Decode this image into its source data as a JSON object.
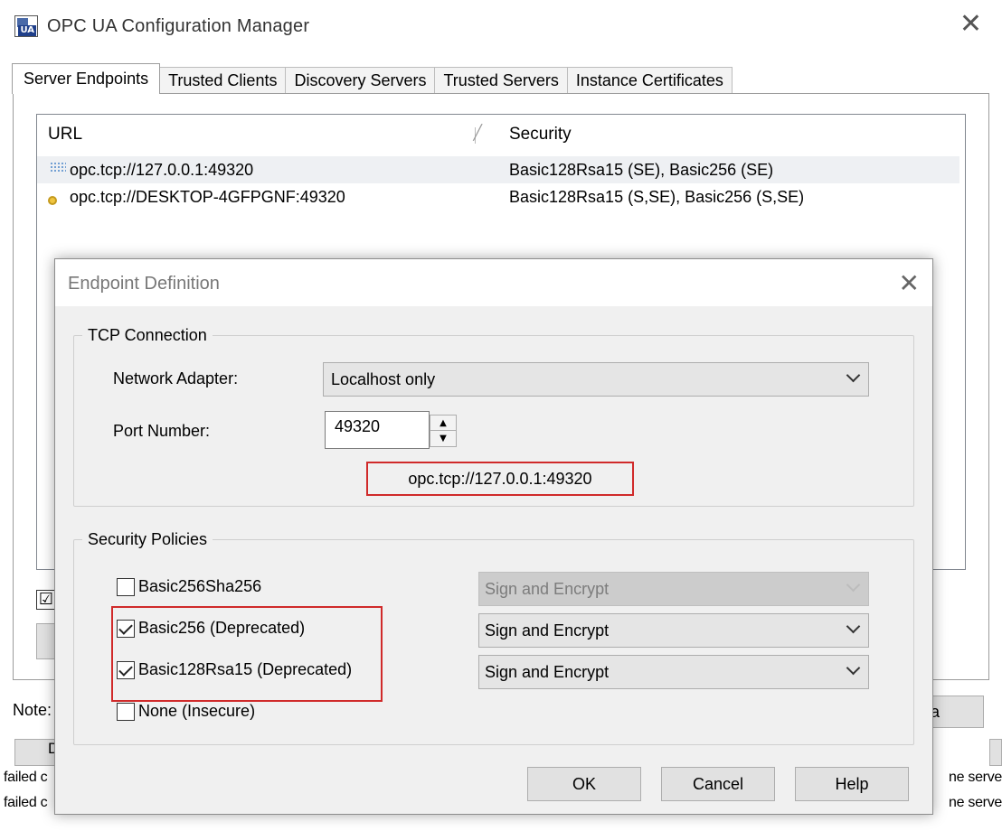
{
  "window": {
    "title": "OPC UA Configuration Manager",
    "close_glyph": "✕"
  },
  "tabs": [
    {
      "label": "Server Endpoints",
      "active": true
    },
    {
      "label": "Trusted Clients",
      "active": false
    },
    {
      "label": "Discovery Servers",
      "active": false
    },
    {
      "label": "Trusted Servers",
      "active": false
    },
    {
      "label": "Instance Certificates",
      "active": false
    }
  ],
  "endpoints": {
    "columns": {
      "url": "URL",
      "security": "Security"
    },
    "rows": [
      {
        "url": "opc.tcp://127.0.0.1:49320",
        "security": "Basic128Rsa15 (SE), Basic256 (SE)",
        "icon": "network-endpoint-icon"
      },
      {
        "url": "opc.tcp://DESKTOP-4GFPGNF:49320",
        "security": "Basic128Rsa15 (S,SE), Basic256 (S,SE)",
        "icon": "key-endpoint-icon"
      }
    ]
  },
  "background": {
    "check_glyph": "☑",
    "note_label": "Note:",
    "button_d_label": "D",
    "right_button_label": "da",
    "log_left": [
      "failed c",
      "failed c"
    ],
    "log_right": [
      "ne serve",
      "ne serve"
    ]
  },
  "dialog": {
    "title": "Endpoint Definition",
    "close_glyph": "✕",
    "tcp_group_label": "TCP Connection",
    "adapter_label": "Network Adapter:",
    "adapter_value": "Localhost only",
    "port_label": "Port Number:",
    "port_value": "49320",
    "url_preview": "opc.tcp://127.0.0.1:49320",
    "security_group_label": "Security Policies",
    "policies": [
      {
        "label": "Basic256Sha256",
        "checked": false,
        "mode": "Sign and Encrypt",
        "enabled": false
      },
      {
        "label": "Basic256 (Deprecated)",
        "checked": true,
        "mode": "Sign and Encrypt",
        "enabled": true
      },
      {
        "label": "Basic128Rsa15 (Deprecated)",
        "checked": true,
        "mode": "Sign and Encrypt",
        "enabled": true
      },
      {
        "label": "None (Insecure)",
        "checked": false
      }
    ],
    "buttons": {
      "ok": "OK",
      "cancel": "Cancel",
      "help": "Help"
    }
  },
  "colors": {
    "highlight": "#d02a2a",
    "dialog_bg": "#f0f0f0"
  }
}
